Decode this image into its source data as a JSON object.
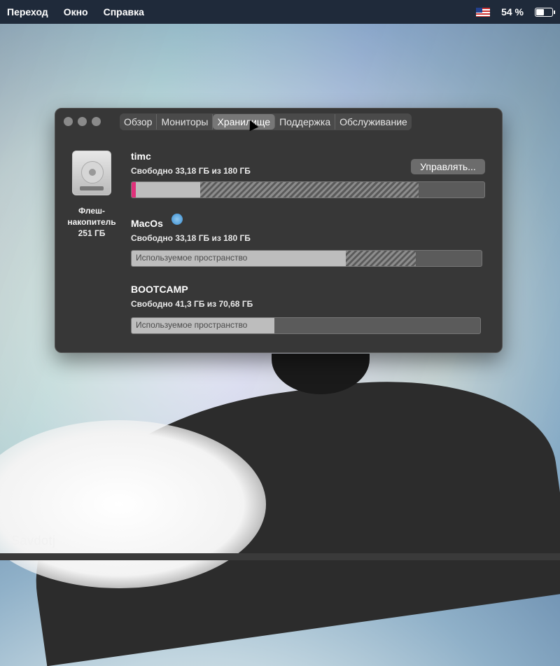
{
  "menubar": {
    "items": [
      "Переход",
      "Окно",
      "Справка"
    ],
    "battery_percent": "54 %",
    "battery_level": 0.54,
    "flag_icon": "us-flag-icon"
  },
  "window": {
    "tabs": [
      "Обзор",
      "Мониторы",
      "Хранилище",
      "Поддержка",
      "Обслуживание"
    ],
    "active_tab": "Хранилище",
    "drive": {
      "name": "Флеш-накопитель 251 ГБ",
      "icon": "hard-drive-icon"
    },
    "manage_button": "Управлять...",
    "volumes": [
      {
        "name": "timc",
        "free_text": "Свободно 33,18 ГБ из 180 ГБ",
        "bar_label": ""
      },
      {
        "name": "MacOs",
        "free_text": "Свободно 33,18 ГБ из 180 ГБ",
        "bar_label": "Используемое пространство"
      },
      {
        "name": "BOOTCAMP",
        "free_text": "Свободно 41,3 ГБ из 70,68 ГБ",
        "bar_label": "Используемое пространство"
      }
    ]
  },
  "watermark": "Savdotj",
  "colors": {
    "menubar": "#1f2a3a",
    "window": "#373737",
    "accent_pink": "#e0307a"
  }
}
